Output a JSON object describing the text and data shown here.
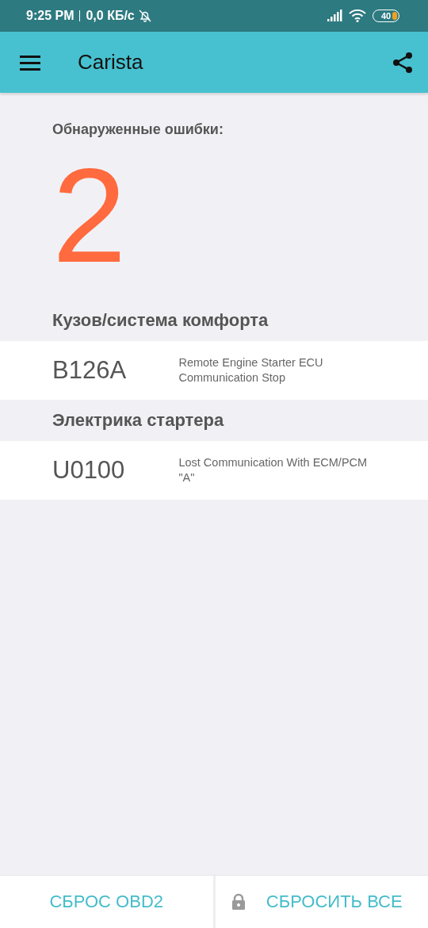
{
  "status_bar": {
    "time": "9:25 PM",
    "speed": "0,0 КБ/с",
    "battery": "40"
  },
  "app_bar": {
    "title": "Carista"
  },
  "summary": {
    "label": "Обнаруженные ошибки:",
    "count": "2"
  },
  "groups": [
    {
      "title": "Кузов/система комфорта",
      "errors": [
        {
          "code": "B126A",
          "description": "Remote Engine Starter ECU Communication Stop"
        }
      ]
    },
    {
      "title": "Электрика стартера",
      "errors": [
        {
          "code": "U0100",
          "description": "Lost Communication With ECM/PCM \"A\""
        }
      ]
    }
  ],
  "buttons": [
    {
      "label": "СБРОС OBD2",
      "locked": false
    },
    {
      "label": "СБРОСИТЬ ВСЕ",
      "locked": true
    }
  ]
}
